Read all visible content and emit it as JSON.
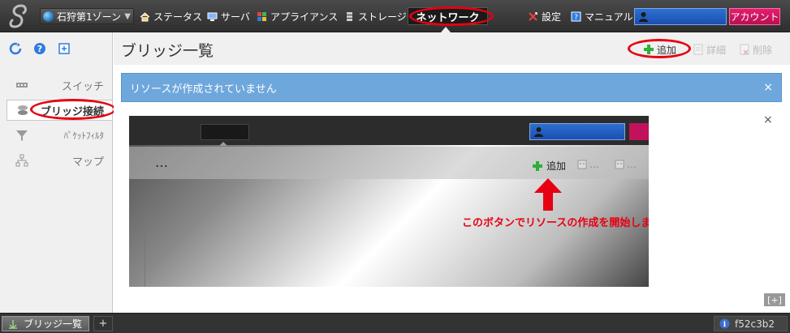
{
  "topbar": {
    "zone_selector": "石狩第1ゾーン",
    "nav": {
      "status": "ステータス",
      "server": "サーバ",
      "appliance": "アプライアンス",
      "storage": "ストレージ",
      "network": "ネットワーク"
    },
    "settings": "設定",
    "manual": "マニュアル",
    "account": "アカウント"
  },
  "sidebar": {
    "items": [
      {
        "label": "スイッチ"
      },
      {
        "label": "ブリッジ接続"
      },
      {
        "label": "ﾊﾟｹｯﾄﾌｨﾙﾀ"
      },
      {
        "label": "マップ"
      }
    ]
  },
  "main": {
    "title": "ブリッジ一覧",
    "actions": {
      "add": "追加",
      "detail": "詳細",
      "delete": "削除"
    },
    "alert": {
      "message": "リソースが作成されていません",
      "close": "×"
    },
    "guide": {
      "close": "×",
      "dots": "…",
      "add": "追加",
      "disabled_dots": "…",
      "caption": "このボタンでリソースの作成を開始します"
    },
    "expand": "[+]"
  },
  "bottombar": {
    "task_label": "ブリッジ一覧",
    "add_tab": "+",
    "build": "f52c3b2"
  },
  "colors": {
    "highlight_ring": "#e60012",
    "account": "#c8125e",
    "alert": "#6ea7dc"
  }
}
